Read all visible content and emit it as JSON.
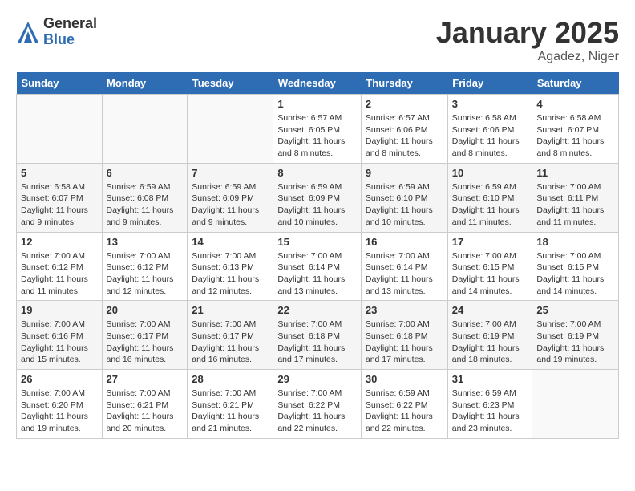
{
  "header": {
    "logo_general": "General",
    "logo_blue": "Blue",
    "month_title": "January 2025",
    "location": "Agadez, Niger"
  },
  "days_of_week": [
    "Sunday",
    "Monday",
    "Tuesday",
    "Wednesday",
    "Thursday",
    "Friday",
    "Saturday"
  ],
  "weeks": [
    [
      {
        "day": "",
        "info": ""
      },
      {
        "day": "",
        "info": ""
      },
      {
        "day": "",
        "info": ""
      },
      {
        "day": "1",
        "info": "Sunrise: 6:57 AM\nSunset: 6:05 PM\nDaylight: 11 hours and 8 minutes."
      },
      {
        "day": "2",
        "info": "Sunrise: 6:57 AM\nSunset: 6:06 PM\nDaylight: 11 hours and 8 minutes."
      },
      {
        "day": "3",
        "info": "Sunrise: 6:58 AM\nSunset: 6:06 PM\nDaylight: 11 hours and 8 minutes."
      },
      {
        "day": "4",
        "info": "Sunrise: 6:58 AM\nSunset: 6:07 PM\nDaylight: 11 hours and 8 minutes."
      }
    ],
    [
      {
        "day": "5",
        "info": "Sunrise: 6:58 AM\nSunset: 6:07 PM\nDaylight: 11 hours and 9 minutes."
      },
      {
        "day": "6",
        "info": "Sunrise: 6:59 AM\nSunset: 6:08 PM\nDaylight: 11 hours and 9 minutes."
      },
      {
        "day": "7",
        "info": "Sunrise: 6:59 AM\nSunset: 6:09 PM\nDaylight: 11 hours and 9 minutes."
      },
      {
        "day": "8",
        "info": "Sunrise: 6:59 AM\nSunset: 6:09 PM\nDaylight: 11 hours and 10 minutes."
      },
      {
        "day": "9",
        "info": "Sunrise: 6:59 AM\nSunset: 6:10 PM\nDaylight: 11 hours and 10 minutes."
      },
      {
        "day": "10",
        "info": "Sunrise: 6:59 AM\nSunset: 6:10 PM\nDaylight: 11 hours and 11 minutes."
      },
      {
        "day": "11",
        "info": "Sunrise: 7:00 AM\nSunset: 6:11 PM\nDaylight: 11 hours and 11 minutes."
      }
    ],
    [
      {
        "day": "12",
        "info": "Sunrise: 7:00 AM\nSunset: 6:12 PM\nDaylight: 11 hours and 11 minutes."
      },
      {
        "day": "13",
        "info": "Sunrise: 7:00 AM\nSunset: 6:12 PM\nDaylight: 11 hours and 12 minutes."
      },
      {
        "day": "14",
        "info": "Sunrise: 7:00 AM\nSunset: 6:13 PM\nDaylight: 11 hours and 12 minutes."
      },
      {
        "day": "15",
        "info": "Sunrise: 7:00 AM\nSunset: 6:14 PM\nDaylight: 11 hours and 13 minutes."
      },
      {
        "day": "16",
        "info": "Sunrise: 7:00 AM\nSunset: 6:14 PM\nDaylight: 11 hours and 13 minutes."
      },
      {
        "day": "17",
        "info": "Sunrise: 7:00 AM\nSunset: 6:15 PM\nDaylight: 11 hours and 14 minutes."
      },
      {
        "day": "18",
        "info": "Sunrise: 7:00 AM\nSunset: 6:15 PM\nDaylight: 11 hours and 14 minutes."
      }
    ],
    [
      {
        "day": "19",
        "info": "Sunrise: 7:00 AM\nSunset: 6:16 PM\nDaylight: 11 hours and 15 minutes."
      },
      {
        "day": "20",
        "info": "Sunrise: 7:00 AM\nSunset: 6:17 PM\nDaylight: 11 hours and 16 minutes."
      },
      {
        "day": "21",
        "info": "Sunrise: 7:00 AM\nSunset: 6:17 PM\nDaylight: 11 hours and 16 minutes."
      },
      {
        "day": "22",
        "info": "Sunrise: 7:00 AM\nSunset: 6:18 PM\nDaylight: 11 hours and 17 minutes."
      },
      {
        "day": "23",
        "info": "Sunrise: 7:00 AM\nSunset: 6:18 PM\nDaylight: 11 hours and 17 minutes."
      },
      {
        "day": "24",
        "info": "Sunrise: 7:00 AM\nSunset: 6:19 PM\nDaylight: 11 hours and 18 minutes."
      },
      {
        "day": "25",
        "info": "Sunrise: 7:00 AM\nSunset: 6:19 PM\nDaylight: 11 hours and 19 minutes."
      }
    ],
    [
      {
        "day": "26",
        "info": "Sunrise: 7:00 AM\nSunset: 6:20 PM\nDaylight: 11 hours and 19 minutes."
      },
      {
        "day": "27",
        "info": "Sunrise: 7:00 AM\nSunset: 6:21 PM\nDaylight: 11 hours and 20 minutes."
      },
      {
        "day": "28",
        "info": "Sunrise: 7:00 AM\nSunset: 6:21 PM\nDaylight: 11 hours and 21 minutes."
      },
      {
        "day": "29",
        "info": "Sunrise: 7:00 AM\nSunset: 6:22 PM\nDaylight: 11 hours and 22 minutes."
      },
      {
        "day": "30",
        "info": "Sunrise: 6:59 AM\nSunset: 6:22 PM\nDaylight: 11 hours and 22 minutes."
      },
      {
        "day": "31",
        "info": "Sunrise: 6:59 AM\nSunset: 6:23 PM\nDaylight: 11 hours and 23 minutes."
      },
      {
        "day": "",
        "info": ""
      }
    ]
  ]
}
